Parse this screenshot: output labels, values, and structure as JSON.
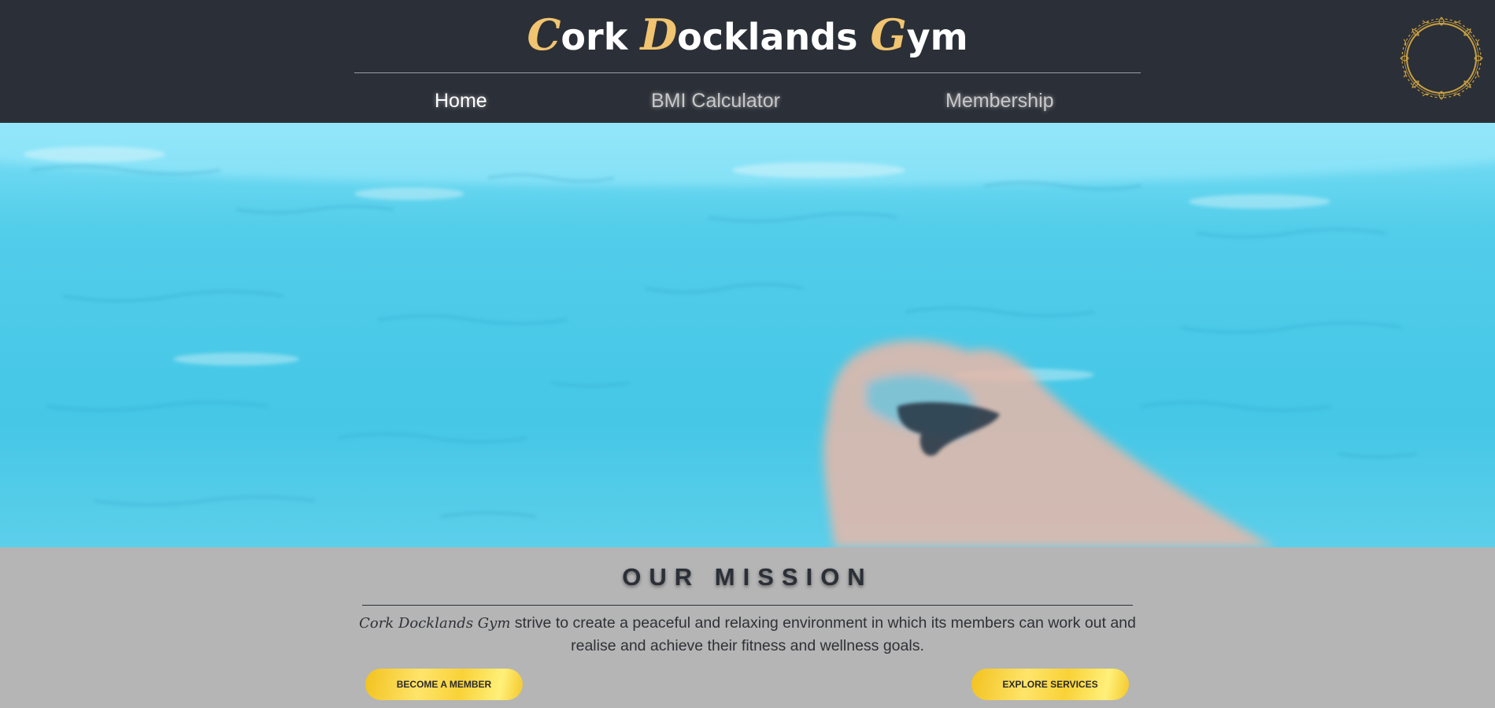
{
  "header": {
    "title_parts": [
      {
        "initial": "C",
        "rest": "ork "
      },
      {
        "initial": "D",
        "rest": "ocklands "
      },
      {
        "initial": "G",
        "rest": "ym"
      }
    ],
    "nav": [
      {
        "label": "Home",
        "active": true
      },
      {
        "label": "BMI Calculator",
        "active": false
      },
      {
        "label": "Membership",
        "active": false
      }
    ],
    "emblem_icon": "ornate-circle-frame-icon"
  },
  "hero": {
    "description": "swimmer-in-pool-image"
  },
  "mission": {
    "heading": "OUR MISSION",
    "brand_name": "Cork Docklands Gym",
    "text_rest": " strive to create a peaceful and relaxing environment in which its members can work out and realise and achieve their fitness and wellness goals.",
    "buttons": {
      "become_member": "BECOME A MEMBER",
      "explore_services": "EXPLORE SERVICES"
    }
  },
  "colors": {
    "header_bg": "#2b2f37",
    "accent_gold": "#f0c470",
    "mission_bg": "#b5b5b5",
    "pool_blue": "#4fcde9"
  }
}
